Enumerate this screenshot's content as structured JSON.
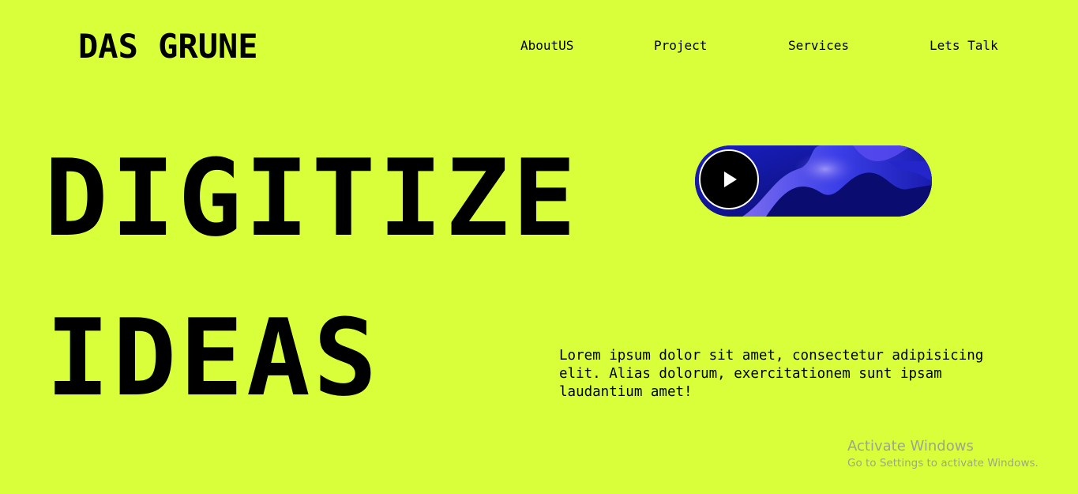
{
  "header": {
    "logo": "DAS GRUNE",
    "nav": [
      "AboutUS",
      "Project",
      "Services",
      "Lets Talk"
    ]
  },
  "hero": {
    "line1": "DIGITIZE",
    "line2": "IDEAS",
    "description": "Lorem ipsum dolor sit amet, consectetur adipisicing elit. Alias dolorum, exercitationem sunt ipsam laudantium amet!"
  },
  "video": {
    "icon": "play-icon"
  },
  "watermark": {
    "title": "Activate Windows",
    "subtitle": "Go to Settings to activate Windows."
  },
  "colors": {
    "background": "#d9ff3b",
    "text": "#000000",
    "video_blue": "#2a2fd6"
  }
}
